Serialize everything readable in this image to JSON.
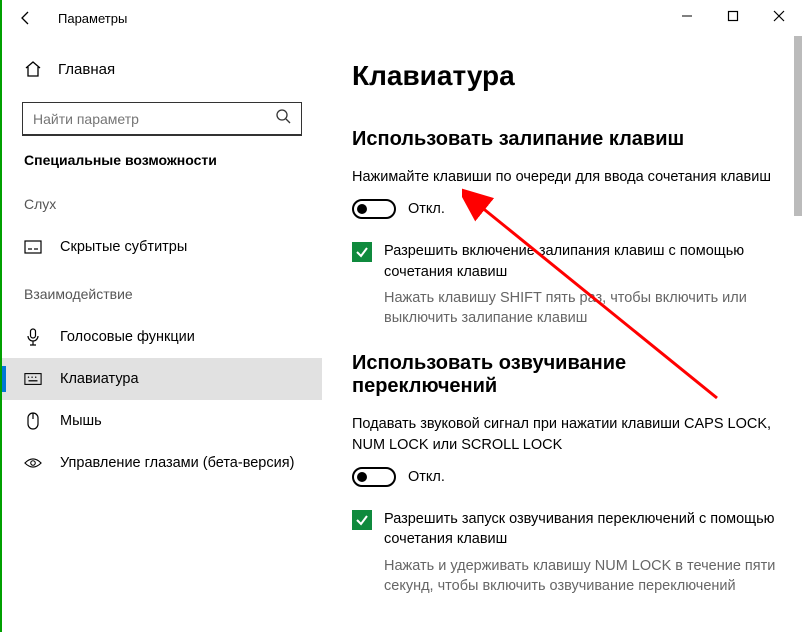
{
  "titlebar": {
    "title": "Параметры"
  },
  "sidebar": {
    "home_label": "Главная",
    "search_placeholder": "Найти параметр",
    "section": "Специальные возможности",
    "cat_hearing": "Слух",
    "cat_interaction": "Взаимодействие",
    "items": {
      "subtitles": "Скрытые субтитры",
      "voice": "Голосовые функции",
      "keyboard": "Клавиатура",
      "mouse": "Мышь",
      "eye": "Управление глазами (бета-версия)"
    }
  },
  "main": {
    "heading": "Клавиатура",
    "sticky": {
      "heading": "Использовать залипание клавиш",
      "desc": "Нажимайте клавиши по очереди для ввода сочетания клавиш",
      "toggle_state": "Откл.",
      "check_label": "Разрешить включение залипания клавиш с помощью сочетания клавиш",
      "check_hint": "Нажать клавишу SHIFT пять раз, чтобы включить или выключить залипание клавиш"
    },
    "toggle_keys": {
      "heading": "Использовать озвучивание переключений",
      "desc": "Подавать звуковой сигнал при нажатии клавиши CAPS LOCK, NUM LOCK или SCROLL LOCK",
      "toggle_state": "Откл.",
      "check_label": "Разрешить запуск озвучивания переключений с помощью сочетания клавиш",
      "check_hint": "Нажать и удерживать клавишу NUM LOCK в течение пяти секунд, чтобы включить озвучивание переключений"
    }
  }
}
